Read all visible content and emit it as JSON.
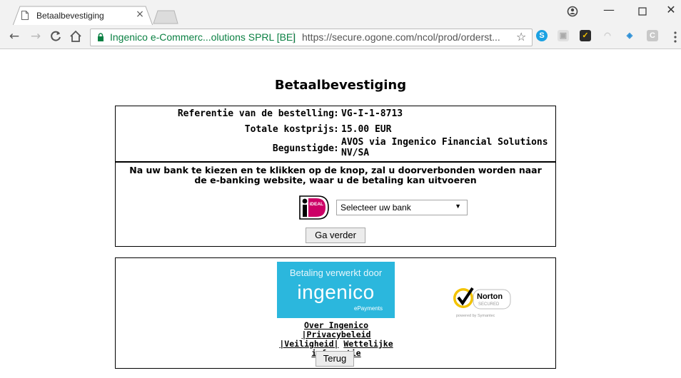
{
  "browser": {
    "tab_title": "Betaalbevestiging",
    "tab_close": "×",
    "site_identity": "Ingenico e-Commerc...olutions SPRL [BE]",
    "url": "https://secure.ogone.com/ncol/prod/orderst...",
    "nav": {
      "back": "←",
      "forward": "→",
      "reload": "C",
      "home": "⌂"
    },
    "window": {
      "user": "●",
      "minimize": "—",
      "maximize": "☐",
      "close": "✕"
    },
    "star": "☆",
    "extensions": {
      "skype": "S",
      "pdf": "▣",
      "norton": "✓",
      "wifi": "◠",
      "shield": "◈",
      "c": "C"
    }
  },
  "page": {
    "title": "Betaalbevestiging",
    "order": {
      "reference_label": "Referentie van de bestelling",
      "reference_value": "VG-I-1-8713",
      "total_label": "Totale kostprijs",
      "total_value": "15.00 EUR",
      "beneficiary_label": "Begunstigde",
      "beneficiary_value_line1": "AVOS via Ingenico Financial Solutions",
      "beneficiary_value_line2": "NV/SA",
      "colon": ":"
    },
    "instruction_line1": "Na uw bank te kiezen en te klikken op de knop, zal u doorverbonden worden naar",
    "instruction_line2": "de e-banking website, waar u de betaling kan uitvoeren",
    "ideal_label": "iDEAL",
    "bank_select": {
      "selected": "Selecteer uw bank",
      "arrow": "▼"
    },
    "continue_button": "Ga verder",
    "footer": {
      "badge_top": "Betaling verwerkt door",
      "badge_brand": "ingenico",
      "badge_sub": "ePayments",
      "norton_name": "Norton",
      "norton_secured": "SECURED",
      "norton_powered": "powered by Symantec",
      "links": {
        "about": "Over Ingenico",
        "privacy": "|Privacybeleid",
        "security": "|Veiligheid|",
        "legal1": "Wettelijke",
        "legal2": "informatie"
      },
      "back_button": "Terug"
    }
  }
}
